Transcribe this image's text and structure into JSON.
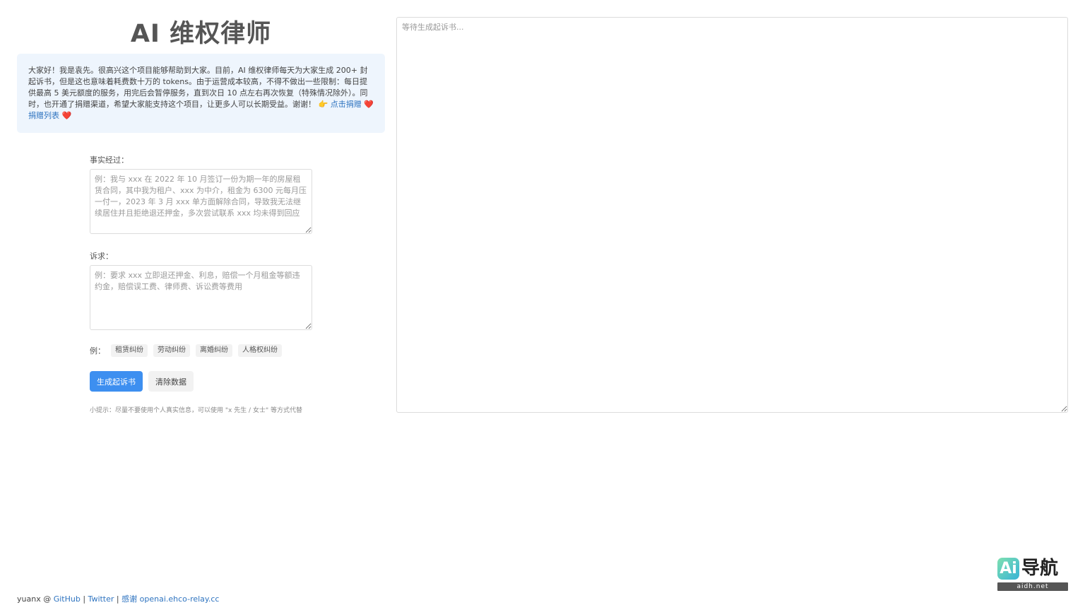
{
  "header": {
    "title": "AI 维权律师"
  },
  "notice": {
    "text": "大家好！我是袁先。很高兴这个项目能够帮助到大家。目前，AI 维权律师每天为大家生成 200+ 封起诉书，但是这也意味着耗费数十万的 tokens。由于运营成本较高，不得不做出一些限制：每日提供最高 5 美元额度的服务，用完后会暂停服务，直到次日 10 点左右再次恢复（特殊情况除外）。同时，也开通了捐赠渠道，希望大家能支持这个项目，让更多人可以长期受益。谢谢！",
    "pointer_emoji": "👉",
    "donate_link": "点击捐赠",
    "heart": "❤️",
    "donor_list_link": "捐赠列表"
  },
  "form": {
    "facts_label": "事实经过：",
    "facts_value": "",
    "facts_placeholder": "例：我与 xxx 在 2022 年 10 月签订一份为期一年的房屋租赁合同，其中我为租户、xxx 为中介，租金为 6300 元每月压一付一，2023 年 3 月 xxx 单方面解除合同，导致我无法继续居住并且拒绝退还押金，多次尝试联系 xxx 均未得到回应",
    "claims_label": "诉求：",
    "claims_value": "",
    "claims_placeholder": "例：要求 xxx 立即退还押金、利息，赔偿一个月租金等额违约金，赔偿误工费、律师费、诉讼费等费用",
    "examples_label": "例：",
    "examples": [
      "租赁纠纷",
      "劳动纠纷",
      "离婚纠纷",
      "人格权纠纷"
    ],
    "generate_button": "生成起诉书",
    "clear_button": "清除数据",
    "tip": "小提示：尽量不要使用个人真实信息，可以使用 \"x 先生 / 女士\" 等方式代替"
  },
  "output": {
    "value": "",
    "placeholder": "等待生成起诉书..."
  },
  "footer": {
    "author": "yuanx @",
    "github": "GitHub",
    "separator": "|",
    "twitter": "Twitter",
    "thanks": "感谢 openai.ehco-relay.cc"
  },
  "watermark": {
    "logo_letters": "Ai",
    "logo_text": "导航",
    "url": "aidh.net"
  },
  "colors": {
    "primary": "#3d8ff0",
    "notice_bg": "#eef5fd",
    "link": "#2f74c0",
    "heart": "#e0245e"
  }
}
